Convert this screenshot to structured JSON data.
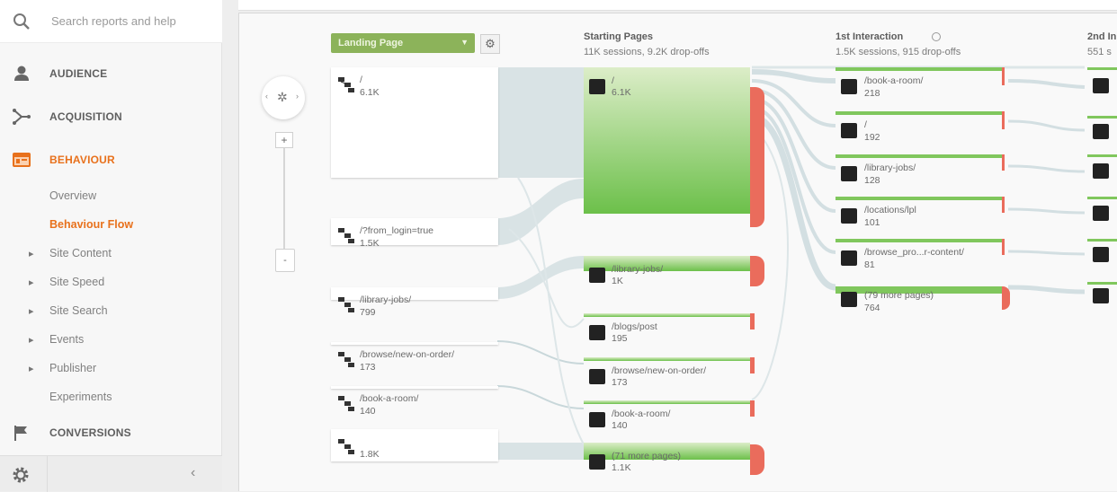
{
  "sidebar": {
    "search_placeholder": "Search reports and help",
    "nav": [
      {
        "label": "AUDIENCE",
        "icon": "person-icon"
      },
      {
        "label": "ACQUISITION",
        "icon": "acquisition-icon"
      },
      {
        "label": "BEHAVIOUR",
        "icon": "behaviour-icon"
      }
    ],
    "behaviour_items": [
      {
        "label": "Overview",
        "bullet": ""
      },
      {
        "label": "Behaviour Flow",
        "bullet": ""
      },
      {
        "label": "Site Content",
        "bullet": "▸"
      },
      {
        "label": "Site Speed",
        "bullet": "▸"
      },
      {
        "label": "Site Search",
        "bullet": "▸"
      },
      {
        "label": "Events",
        "bullet": "▸"
      },
      {
        "label": "Publisher",
        "bullet": "▸"
      },
      {
        "label": "Experiments",
        "bullet": ""
      }
    ],
    "conversions_label": "CONVERSIONS",
    "collapse_glyph": "‹"
  },
  "flow": {
    "dimension_select": "Landing Page",
    "columns": {
      "starting": {
        "title": "Starting Pages",
        "subtitle": "11K sessions, 9.2K drop-offs"
      },
      "first": {
        "title": "1st Interaction",
        "subtitle": "1.5K sessions, 915 drop-offs"
      },
      "second": {
        "title": "2nd In",
        "subtitle": "551 s"
      }
    },
    "landing_nodes": [
      {
        "name": "/",
        "value": "6.1K"
      },
      {
        "name": "/?from_login=true",
        "value": "1.5K"
      },
      {
        "name": "/library-jobs/",
        "value": "799"
      },
      {
        "name": "/browse/new-on-order/",
        "value": "173"
      },
      {
        "name": "/book-a-room/",
        "value": "140"
      },
      {
        "name": "",
        "value": "1.8K"
      }
    ],
    "starting_nodes": [
      {
        "name": "/",
        "value": "6.1K"
      },
      {
        "name": "/library-jobs/",
        "value": "1K"
      },
      {
        "name": "/blogs/post",
        "value": "195"
      },
      {
        "name": "/browse/new-on-order/",
        "value": "173"
      },
      {
        "name": "/book-a-room/",
        "value": "140"
      },
      {
        "name": "(71 more pages)",
        "value": "1.1K"
      }
    ],
    "first_nodes": [
      {
        "name": "/book-a-room/",
        "value": "218"
      },
      {
        "name": "/",
        "value": "192"
      },
      {
        "name": "/library-jobs/",
        "value": "128"
      },
      {
        "name": "/locations/lpl",
        "value": "101"
      },
      {
        "name": "/browse_pro...r-content/",
        "value": "81"
      },
      {
        "name": "(79 more pages)",
        "value": "764"
      }
    ]
  }
}
